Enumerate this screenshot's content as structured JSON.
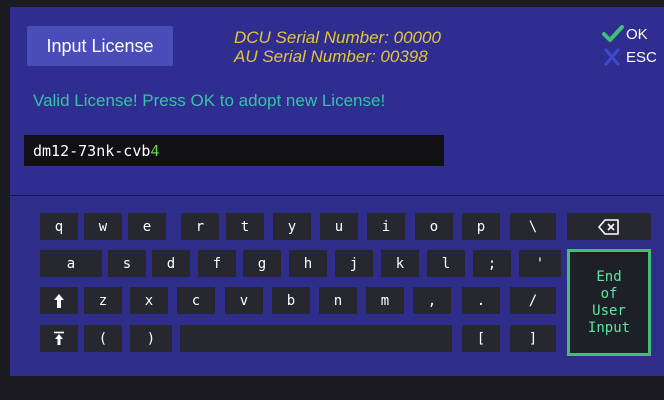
{
  "header": {
    "title_button": "Input License",
    "dcu_serial": "DCU Serial Number: 00000",
    "au_serial": "AU Serial Number: 00398"
  },
  "actions": {
    "ok": {
      "label": "OK",
      "icon": "checkmark-icon",
      "color": "#3fbf78"
    },
    "esc": {
      "label": "ESC",
      "icon": "x-icon",
      "color": "#3c4cc8"
    }
  },
  "status_message": "Valid License! Press OK to adopt new License!",
  "license_input": {
    "value_main": "dm12-73nk-cvb",
    "value_last": "4"
  },
  "keyboard": {
    "rows": [
      [
        "q",
        "w",
        "e",
        "r",
        "t",
        "y",
        "u",
        "i",
        "o",
        "p",
        "\\"
      ],
      [
        "a",
        "s",
        "d",
        "f",
        "g",
        "h",
        "j",
        "k",
        "l",
        ";",
        "'"
      ],
      [
        "⬆",
        "z",
        "x",
        "c",
        "v",
        "b",
        "n",
        "m",
        ",",
        ".",
        "/"
      ],
      [
        "↥",
        "(",
        ")",
        "",
        "[",
        "]"
      ]
    ],
    "backspace_icon": "backspace-icon",
    "shift_icon": "shift-icon",
    "caps_icon": "caps-lock-icon",
    "end_key_lines": [
      "End",
      "of",
      "User",
      "Input"
    ]
  },
  "colors": {
    "panel": "#2f2e90",
    "accent_yellow": "#e2c53a",
    "status_teal": "#35c2a8",
    "end_green": "#3fbf78"
  }
}
